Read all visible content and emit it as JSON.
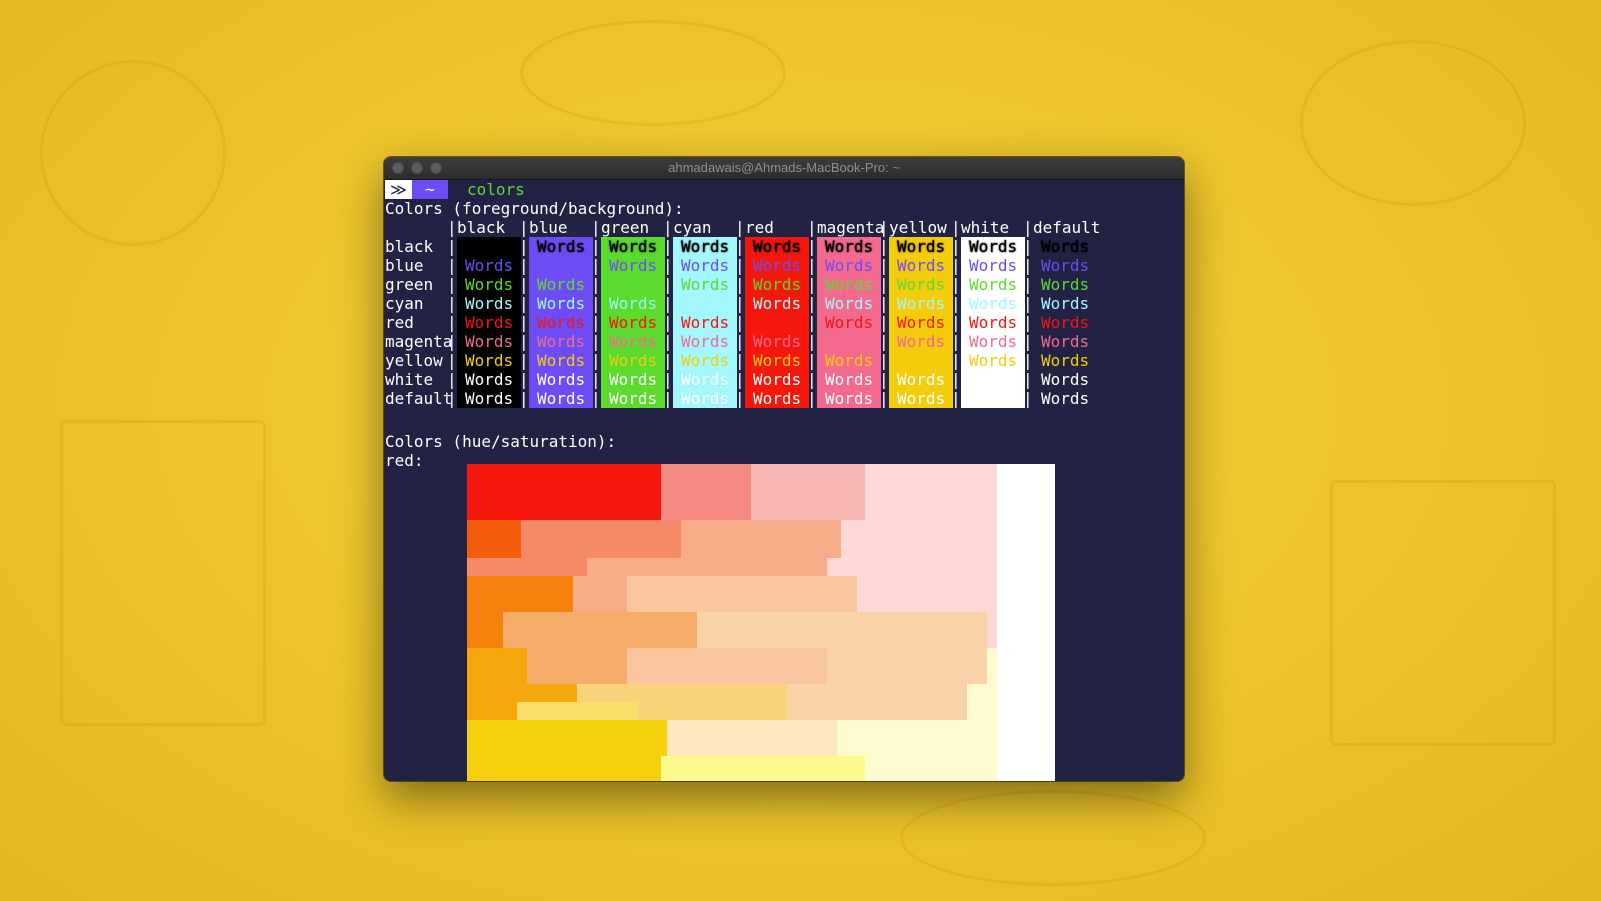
{
  "window": {
    "title": "ahmadawais@Ahmads-MacBook-Pro: ~"
  },
  "prompt": {
    "segment1": "≫",
    "segment2": "~",
    "command": "colors"
  },
  "section1_title": "Colors (foreground/background):",
  "section2_title": "Colors (hue/saturation):",
  "section2_row_label": "red:",
  "sample_text": "Words",
  "columns": [
    "black",
    "blue",
    "green",
    "cyan",
    "red",
    "magenta",
    "yellow",
    "white",
    "default"
  ],
  "rows": [
    "black",
    "blue",
    "green",
    "cyan",
    "red",
    "magenta",
    "yellow",
    "white",
    "default"
  ],
  "palette": {
    "black": "#000000",
    "blue": "#6e4cf5",
    "green": "#5bdb2e",
    "cyan": "#a3f7ff",
    "red": "#f5160c",
    "magenta": "#f4698e",
    "yellow": "#f5cc0a",
    "white": "#ffffff",
    "default": "#ffffff",
    "terminal_bg": "#222244"
  },
  "hue_colors": [
    "#f5160c",
    "#f58a82",
    "#f8b8b3",
    "#fcd8d6",
    "#f45d0c",
    "#f58a68",
    "#f6ac88",
    "#f8c59e",
    "#f5820c",
    "#f6ad6a",
    "#fad2a8",
    "#f5a70c",
    "#f9d27a",
    "#fde8bf",
    "#f5d00c",
    "#fbdd6a",
    "#fdfb8e",
    "#fffbd0",
    "#ffffff",
    "#f1f1f1"
  ]
}
